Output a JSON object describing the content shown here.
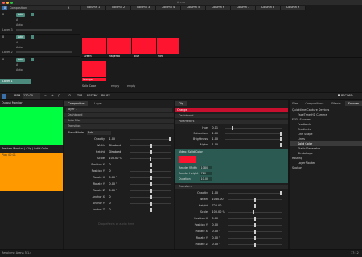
{
  "window": {
    "title": "Arena"
  },
  "layers": {
    "composition_label": "Composition",
    "x_label": "X",
    "rows": [
      {
        "name": "Layer 3",
        "b": "B",
        "add": "Add",
        "a": "A",
        "auto": "Auto"
      },
      {
        "name": "Layer 2",
        "b": "B",
        "add": "Add",
        "a": "A",
        "auto": "Auto"
      },
      {
        "name": "Layer 1",
        "b": "B",
        "add": "Add",
        "a": "A",
        "auto": "Auto"
      }
    ]
  },
  "columns": [
    "Column 1",
    "Column 2",
    "Column 3",
    "Column 4",
    "Column 5",
    "Column 6",
    "Column 7",
    "Column 8",
    "Column 9"
  ],
  "clips": {
    "row2": [
      "Green",
      "Magenta",
      "Blue",
      "Mint"
    ],
    "row3": [
      "Orange"
    ],
    "row4": [
      "Solid Color",
      "empty",
      "empty"
    ]
  },
  "transport": {
    "bpm_label": "BPM",
    "bpm": "120.00",
    "minus": "−",
    "plus": "+",
    "div": "/2",
    "times": "*2",
    "tap": "TAP",
    "resync": "RESYNC",
    "pause": "PAUSE",
    "record": "RECORD"
  },
  "output": {
    "title": "Output Monitor",
    "preview_title": "Preview Monitor | Clip | Solid Color",
    "preview_label": "Play 00:01",
    "output_color": "#00ff40",
    "preview_color": "#ff9900"
  },
  "tabs": {
    "composition": "Composition",
    "layer": "Layer",
    "clip": "Clip",
    "files": "Files",
    "compositions": "Compositions",
    "effects": "Effects",
    "sources": "Sources"
  },
  "layer_panel": {
    "name": "layer 1",
    "dashboard": "Dashboard",
    "autopilot": "Auto Pilot",
    "transition": "Transition",
    "blend_label": "Blend Mode",
    "blend_value": "Add",
    "props": [
      {
        "label": "Opacity",
        "value": "1.00"
      },
      {
        "label": "Width",
        "value": "Disabled"
      },
      {
        "label": "Height",
        "value": "Disabled"
      },
      {
        "label": "Scale",
        "value": "100.00 %"
      },
      {
        "label": "Position X",
        "value": "0"
      },
      {
        "label": "Position Y",
        "value": "0"
      },
      {
        "label": "Rotate X",
        "value": "0.00 °"
      },
      {
        "label": "Rotate Y",
        "value": "0.00 °"
      },
      {
        "label": "Rotate Z",
        "value": "0.00 °"
      },
      {
        "label": "Anchor X",
        "value": "0"
      },
      {
        "label": "Anchor Y",
        "value": "0"
      },
      {
        "label": "Anchor Z",
        "value": "0"
      }
    ],
    "drop_hint": "Drop effects or audio here"
  },
  "clip_panel": {
    "name": "Orange",
    "dashboard": "Dashboard",
    "parameters": "Parameters",
    "params": [
      {
        "label": "Hue",
        "value": "0.11"
      },
      {
        "label": "Saturation",
        "value": "1.00"
      },
      {
        "label": "Brightness",
        "value": "1.00"
      },
      {
        "label": "Alpha",
        "value": "1.00"
      }
    ],
    "video_section": "Video, Solid Color",
    "render": [
      {
        "label": "Render Width",
        "value": "1080"
      },
      {
        "label": "Render Height",
        "value": "720"
      },
      {
        "label": "Duration",
        "value": "10.00"
      }
    ],
    "transform": "Transform",
    "transform_props": [
      {
        "label": "Opacity",
        "value": "1.00"
      },
      {
        "label": "Width",
        "value": "1080.00"
      },
      {
        "label": "Height",
        "value": "720.00"
      },
      {
        "label": "Scale",
        "value": "100.00 %"
      },
      {
        "label": "Position X",
        "value": "0.00"
      },
      {
        "label": "Position Y",
        "value": "0.00"
      },
      {
        "label": "Rotate X",
        "value": "0.00 °"
      },
      {
        "label": "Rotate Y",
        "value": "0.00 °"
      },
      {
        "label": "Rotate Z",
        "value": "0.00 °"
      }
    ]
  },
  "sources": {
    "items": [
      {
        "label": "Quicktime Capture Devices",
        "depth": 0
      },
      {
        "label": "FaceTime HD Camera",
        "depth": 1
      },
      {
        "label": "FFGL Sources",
        "depth": 0
      },
      {
        "label": "Feedback",
        "depth": 1
      },
      {
        "label": "Gradients",
        "depth": 1
      },
      {
        "label": "Line Scape",
        "depth": 1
      },
      {
        "label": "Lines",
        "depth": 1
      },
      {
        "label": "Solid Color",
        "depth": 1,
        "selected": true
      },
      {
        "label": "Static Generator",
        "depth": 1
      },
      {
        "label": "Strobotope",
        "depth": 1
      },
      {
        "label": "Routing",
        "depth": 0
      },
      {
        "label": "Layer Router",
        "depth": 1
      },
      {
        "label": "Syphon",
        "depth": 0
      }
    ]
  },
  "status": {
    "app": "Resolume Arena 5.1.4",
    "time": "17:12"
  }
}
